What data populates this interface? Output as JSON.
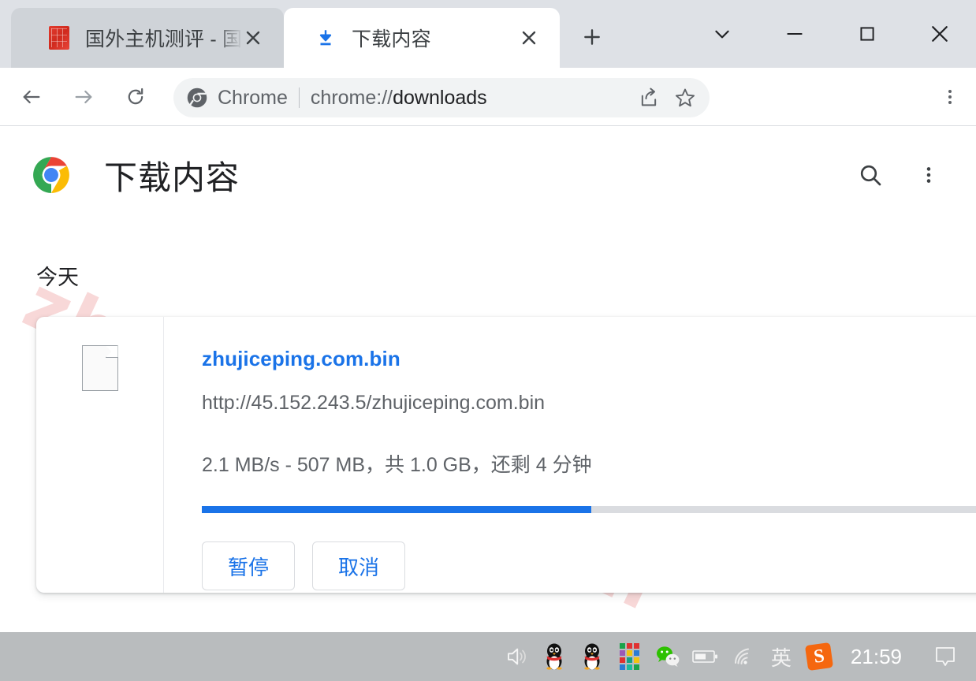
{
  "browser": {
    "tabs": [
      {
        "title": "国外主机测评 - 国外",
        "favicon": "red-seal-favicon",
        "active": false,
        "close_label": "×"
      },
      {
        "title": "下载内容",
        "favicon": "download-icon",
        "active": true,
        "close_label": "×"
      }
    ],
    "new_tab_label": "+",
    "window_controls": {
      "tab_search": "chevron-down-icon",
      "minimize": "minimize-icon",
      "maximize": "maximize-icon",
      "close": "close-icon"
    },
    "toolbar": {
      "back": "back-arrow-icon",
      "forward": "forward-arrow-icon",
      "reload": "reload-icon",
      "omnibox": {
        "icon": "chrome-icon",
        "scheme_label": "Chrome",
        "url_prefix": "chrome://",
        "url_main": "downloads",
        "share_icon": "share-icon",
        "bookmark_icon": "star-icon"
      },
      "menu_icon": "three-dot-menu-icon"
    }
  },
  "downloads_page": {
    "logo": "chrome-logo",
    "title": "下载内容",
    "search_icon": "search-icon",
    "menu_icon": "three-dot-menu-icon",
    "date_group": "今天",
    "watermark": "zhujiceping.com",
    "item": {
      "file_icon": "generic-file-icon",
      "filename": "zhujiceping.com.bin",
      "url": "http://45.152.243.5/zhujiceping.com.bin",
      "status": "2.1 MB/s - 507 MB，共 1.0 GB，还剩 4 分钟",
      "progress_percent": 50,
      "pause_label": "暂停",
      "cancel_label": "取消"
    }
  },
  "taskbar": {
    "tray_icons": [
      "volume-icon",
      "qq-icon",
      "qq-icon",
      "color-grid-icon",
      "wechat-icon",
      "battery-icon",
      "wifi-icon",
      "ime-english-icon",
      "sogou-icon"
    ],
    "ime_label": "英",
    "sogou_label": "S",
    "clock": "21:59",
    "notification_icon": "notification-icon"
  },
  "colors": {
    "accent_blue": "#1a73e8",
    "tabstrip_bg": "#dee1e6",
    "inactive_tab": "#cfd3d8",
    "taskbar_bg": "#b9bcbe",
    "watermark_pink": "#f8d8d8"
  }
}
